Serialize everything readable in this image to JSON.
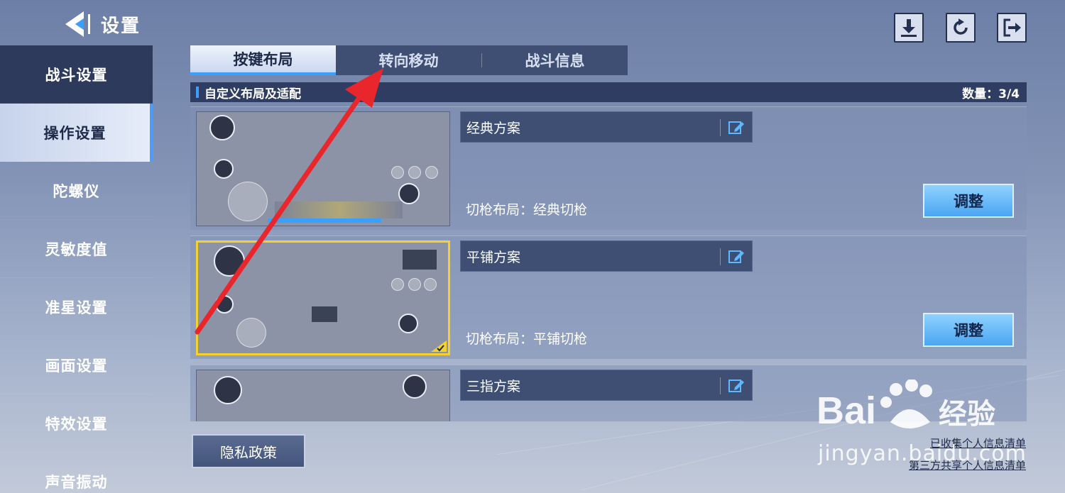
{
  "header": {
    "title": "设置"
  },
  "top_buttons": [
    {
      "icon": "download-icon"
    },
    {
      "icon": "refresh-icon"
    },
    {
      "icon": "exit-icon"
    }
  ],
  "sidebar": {
    "items": [
      {
        "label": "战斗设置"
      },
      {
        "label": "操作设置"
      },
      {
        "label": "陀螺仪"
      },
      {
        "label": "灵敏度值"
      },
      {
        "label": "准星设置"
      },
      {
        "label": "画面设置"
      },
      {
        "label": "特效设置"
      },
      {
        "label": "声音振动"
      }
    ],
    "active_index": 1
  },
  "tabs": [
    {
      "label": "按键布局"
    },
    {
      "label": "转向移动"
    },
    {
      "label": "战斗信息"
    }
  ],
  "section": {
    "title": "自定义布局及适配",
    "count": "数量：3/4"
  },
  "layouts": [
    {
      "name": "经典方案",
      "switch_layout": "切枪布局：经典切枪",
      "adjust_label": "调整",
      "selected": false
    },
    {
      "name": "平铺方案",
      "switch_layout": "切枪布局：平铺切枪",
      "adjust_label": "调整",
      "selected": true
    },
    {
      "name": "三指方案"
    }
  ],
  "footer": {
    "privacy_label": "隐私政策",
    "link_collected": "已收集个人信息清单",
    "link_shared": "第三方共享个人信息清单"
  },
  "watermark": {
    "brand": "Baidu",
    "brand_cn": "经验",
    "url": "jingyan.baidu.com"
  },
  "colors": {
    "accent": "#3aa0ff",
    "selected_border": "#f6d12b",
    "annotation_arrow": "#e8262b"
  }
}
